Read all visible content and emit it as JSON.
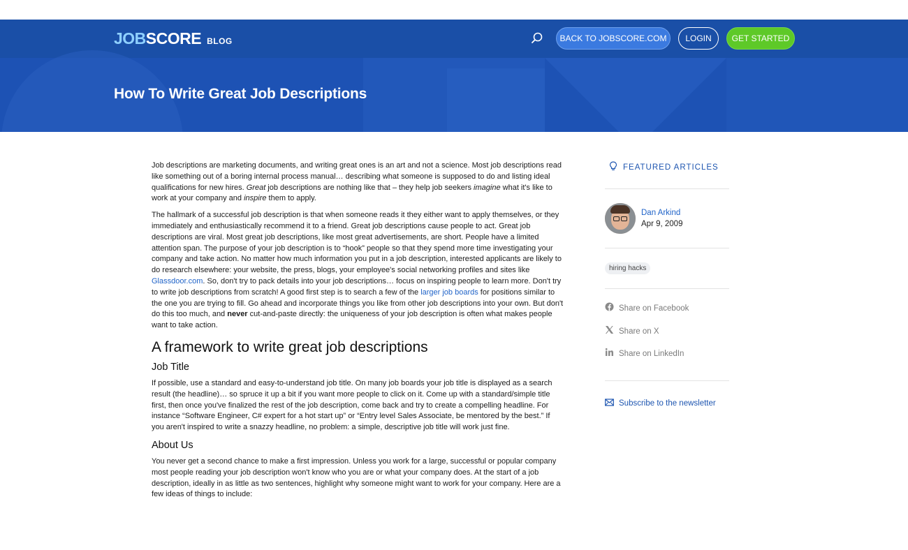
{
  "header": {
    "logo_job": "JOB",
    "logo_score": "SCORE",
    "logo_blog": "BLOG",
    "back_label": "BACK TO JOBSCORE.COM",
    "login_label": "LOGIN",
    "start_label": "GET STARTED",
    "search_icon": "search-icon"
  },
  "hero": {
    "title": "How To Write Great Job Descriptions"
  },
  "article": {
    "p1_a": "Job descriptions are marketing documents, and writing great ones is an art and not a science. Most job descriptions read like something out of a boring internal process manual… describing what someone is supposed to do and listing ideal qualifications for new hires. ",
    "p1_great": "Great",
    "p1_b": " job descriptions are nothing like that – they help job seekers ",
    "p1_imagine": "imagine",
    "p1_c": " what it's like to work at your company and ",
    "p1_inspire": "inspire",
    "p1_d": " them to apply.",
    "p2_a": "The hallmark of a successful job description is that when someone reads it they either want to apply themselves, or they immediately and enthusiastically recommend it to a friend. Great job descriptions cause people to act. Great job descriptions are viral. Most great job descriptions, like most great advertisements, are short. People have a limited attention span. The purpose of your job description is to “hook” people so that they spend more time investigating your company and take action. No matter how much information you put in a job description, interested applicants are likely to do research elsewhere: your website, the press, blogs, your employee's social networking profiles and sites like ",
    "p2_link1": "Glassdoor.com",
    "p2_b": ". So, don't try to pack details into your job descriptions… focus on inspiring people to learn more. Don't try to write job descriptions from scratch! A good first step is to search a few of the ",
    "p2_link2": "larger job boards",
    "p2_c": " for positions similar to the one you are trying to fill. Go ahead and incorporate things you like from other job descriptions into your own. But don't do this too much, and ",
    "p2_never": "never",
    "p2_d": " cut-and-paste directly: the uniqueness of your job description is often what makes people want to take action.",
    "h2": "A framework to write great job descriptions",
    "h3_title": "Job Title",
    "p3": "If possible, use a standard and easy-to-understand job title. On many job boards your job title is displayed as a search result (the headline)… so spruce it up a bit if you want more people to click on it. Come up with a standard/simple title first, then once you've finalized the rest of the job description, come back and try to create a compelling headline. For instance “Software Engineer, C# expert for a hot start up” or “Entry level Sales Associate, be mentored by the best.” If you aren't inspired to write a snazzy headline, no problem: a simple, descriptive job title will work just fine.",
    "h3_about": "About Us",
    "p4": "You never get a second chance to make a first impression. Unless you work for a large, successful or popular company most people reading your job description won't know who you are or what your company does. At the start of a job description, ideally in as little as two sentences, highlight why someone might want to work for your company. Here are a few ideas of things to include:"
  },
  "sidebar": {
    "featured_label": "FEATURED ARTICLES",
    "author_name": "Dan Arkind",
    "author_date": "Apr 9, 2009",
    "tag": "hiring hacks",
    "share_facebook": "Share on Facebook",
    "share_x": "Share on X",
    "share_linkedin": "Share on LinkedIn",
    "subscribe": "Subscribe to the newsletter"
  },
  "colors": {
    "hero_blue": "#1d52b4",
    "link_blue": "#1f63c8",
    "cta_green": "#5ec928"
  }
}
